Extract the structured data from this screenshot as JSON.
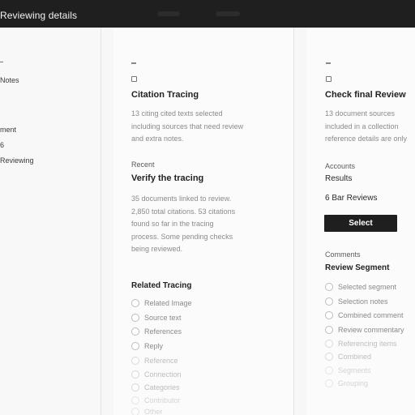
{
  "topbar": {
    "title": "Reviewing details"
  },
  "sidebar": {
    "items": [
      {
        "label": "Notes"
      },
      {
        "label": "ment"
      },
      {
        "label": "6"
      },
      {
        "label": "Reviewing"
      }
    ]
  },
  "middle": {
    "section_title": "Citation Tracing",
    "description": [
      "13 citing cited texts selected",
      "including sources that need review",
      "and extra notes."
    ],
    "meta_label": "Recent",
    "meta_title": "Verify the tracing",
    "meta_body": [
      "35 documents linked to review.",
      "2,850 total citations. 53 citations",
      "found so far in the tracing",
      "process. Some pending checks",
      "being reviewed."
    ],
    "options_title": "Related Tracing",
    "options": [
      {
        "label": "Related Image"
      },
      {
        "label": "Source text"
      },
      {
        "label": "References"
      },
      {
        "label": "Reply"
      },
      {
        "label": "Reference"
      },
      {
        "label": "Connection"
      },
      {
        "label": "Categories"
      },
      {
        "label": "Contributor"
      },
      {
        "label": "Other"
      }
    ]
  },
  "right": {
    "section_title": "Check final Review",
    "description": [
      "13 document sources",
      "included in a collection",
      "reference details are only"
    ],
    "meta_label": "Accounts",
    "value1": "Results",
    "value2": "6 Bar Reviews",
    "button_label": "Select",
    "list_label": "Comments",
    "list_title": "Review Segment",
    "options": [
      {
        "label": "Selected segment"
      },
      {
        "label": "Selection notes"
      },
      {
        "label": "Combined comment"
      },
      {
        "label": "Review commentary"
      },
      {
        "label": "Referencing items"
      },
      {
        "label": "Combined"
      },
      {
        "label": "Segments"
      },
      {
        "label": "Grouping"
      }
    ]
  }
}
